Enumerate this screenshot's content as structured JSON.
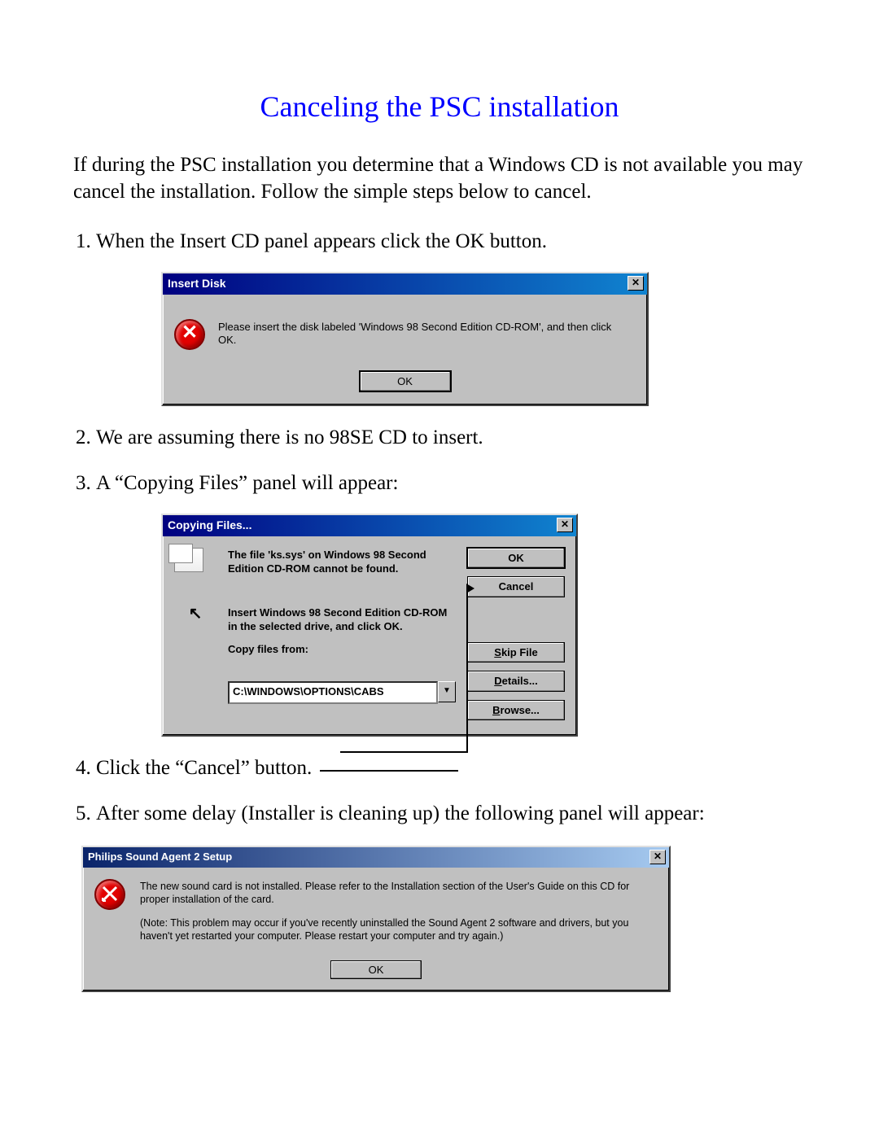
{
  "title": "Canceling the PSC installation",
  "intro": "If during the PSC installation you determine that a Windows CD is not available you may cancel the installation. Follow the simple steps below to cancel.",
  "steps": {
    "s1": "When the Insert CD panel appears click the OK button.",
    "s2": "We are assuming there is no 98SE CD to insert.",
    "s3": "A “Copying Files” panel will appear:",
    "s4": "Click the “Cancel” button.",
    "s5": "After some delay (Installer is cleaning up) the following panel will appear:"
  },
  "dialog1": {
    "title": "Insert Disk",
    "message": "Please insert the disk labeled 'Windows 98 Second Edition CD-ROM', and then click OK.",
    "ok": "OK"
  },
  "dialog2": {
    "title": "Copying Files...",
    "msg1": "The file 'ks.sys' on Windows 98 Second Edition CD-ROM cannot be found.",
    "msg2": "Insert Windows 98 Second Edition CD-ROM in the selected drive, and click OK.",
    "label": "Copy files from:",
    "path": "C:\\WINDOWS\\OPTIONS\\CABS",
    "buttons": {
      "ok": "OK",
      "cancel": "Cancel",
      "skip": "Skip File",
      "details": "Details...",
      "browse": "Browse..."
    }
  },
  "dialog3": {
    "title": "Philips Sound Agent 2 Setup",
    "p1": "The new sound card is not installed. Please refer to the Installation section of the User's Guide on this CD for proper installation of the card.",
    "p2": "(Note: This problem may occur if you've recently uninstalled the Sound Agent 2 software and drivers, but you haven't yet restarted your computer.  Please restart your computer and try again.)",
    "ok": "OK"
  },
  "glyphs": {
    "close": "✕",
    "dropdown": "▼",
    "cursor": "↖"
  }
}
